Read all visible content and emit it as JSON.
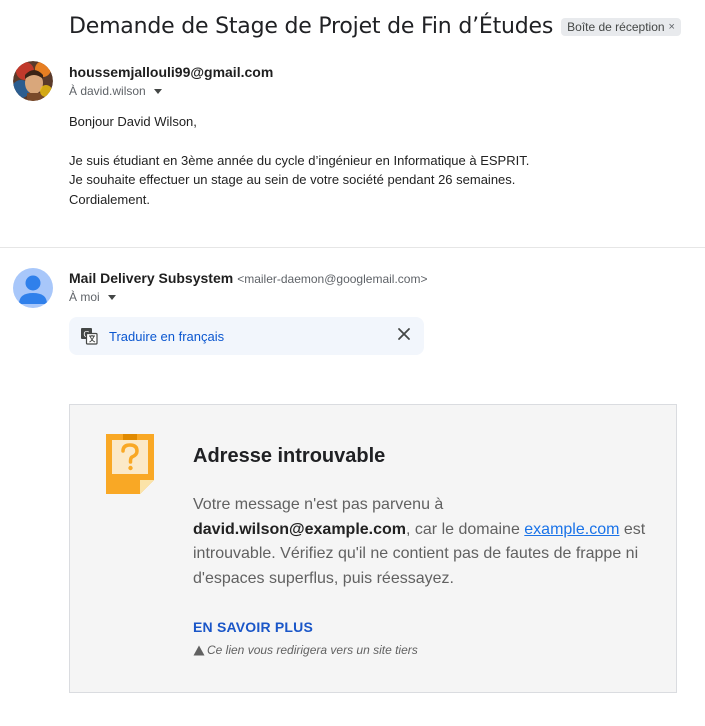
{
  "subject": "Demande de Stage de Projet de Fin d’Études",
  "label_chip": {
    "text": "Boîte de réception",
    "close": "×"
  },
  "message1": {
    "sender": "houssemjallouli99@gmail.com",
    "to": "À david.wilson",
    "greeting": "Bonjour David Wilson,",
    "line1": "Je suis étudiant en 3ème année du cycle d’ingénieur en Informatique à ESPRIT.",
    "line2": "Je souhaite effectuer un stage au sein de votre société pendant 26 semaines.",
    "closing": "Cordialement."
  },
  "message2": {
    "sender_name": "Mail Delivery Subsystem",
    "sender_email": "<mailer-daemon@googlemail.com>",
    "to": "À moi",
    "translate_label": "Traduire en français"
  },
  "bounce": {
    "title": "Adresse introuvable",
    "text_part1": "Votre message n'est pas parvenu à ",
    "address": "david.wilson@example.com",
    "text_part2": ", car le domaine ",
    "domain": "example.com",
    "text_part3": " est introuvable. Vérifiez qu'il ne contient pas de fautes de frappe ni d'espaces superflus, puis réessayez.",
    "learn_more": "EN SAVOIR PLUS",
    "warning": "Ce lien vous redirigera vers un site tiers"
  },
  "icons": {
    "avatar1": "avatar-photo",
    "avatar2": "person-icon",
    "translate": "translate-icon",
    "close": "close-icon",
    "bounce": "question-note-icon",
    "warning": "warning-triangle-icon"
  },
  "colors": {
    "link_blue": "#0b57d0",
    "learn_more_blue": "#1a56c8",
    "card_bg": "#f5f5f5",
    "note_orange": "#f9a825"
  }
}
